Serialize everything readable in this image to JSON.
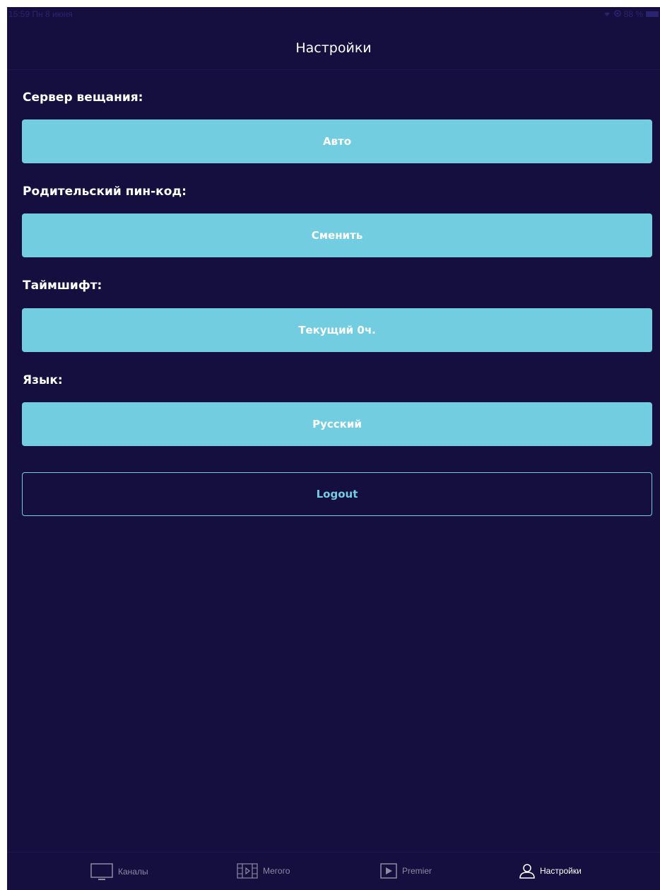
{
  "status_bar": {
    "time": "15:59  Пн 8 июня",
    "battery": "88 %"
  },
  "nav": {
    "title": "Настройки"
  },
  "sections": [
    {
      "label": "Сервер вещания:",
      "value": "Авто"
    },
    {
      "label": "Родительский пин-код:",
      "value": "Сменить"
    },
    {
      "label": "Таймшифт:",
      "value": "Текущий 0ч."
    },
    {
      "label": "Язык:",
      "value": "Русский"
    }
  ],
  "logout": {
    "label": "Logout"
  },
  "tab_bar": {
    "tabs": [
      {
        "label": "Каналы",
        "icon": "tv-icon",
        "active": false
      },
      {
        "label": "Мегого",
        "icon": "film-icon",
        "active": false
      },
      {
        "label": "Premier",
        "icon": "play-icon",
        "active": false
      },
      {
        "label": "Настройки",
        "icon": "user-icon",
        "active": true
      }
    ]
  },
  "colors": {
    "background": "#150f3f",
    "accent": "#72cde0",
    "text": "#ffffff",
    "tab_inactive": "#8d8aa6"
  }
}
